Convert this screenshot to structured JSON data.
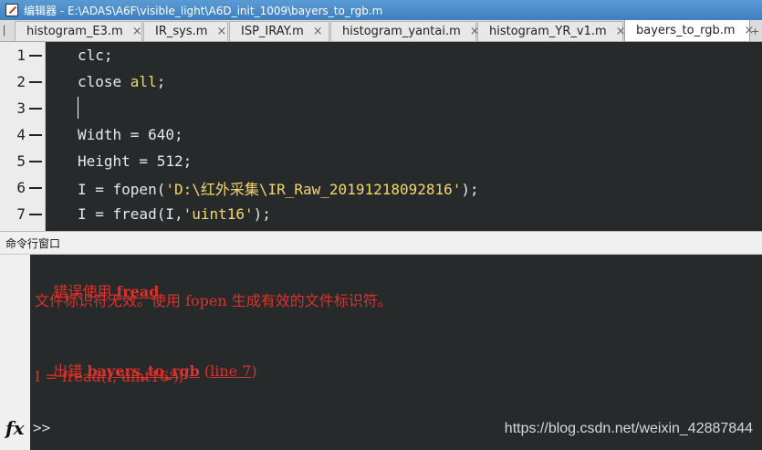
{
  "window": {
    "title": "编辑器 - E:\\ADAS\\A6F\\visible_light\\A6D_init_1009\\bayers_to_rgb.m"
  },
  "tabs": [
    {
      "label": "histogram_E3.m"
    },
    {
      "label": "IR_sys.m"
    },
    {
      "label": "ISP_IRAY.m"
    },
    {
      "label": "histogram_yantai.m"
    },
    {
      "label": "histogram_YR_v1.m"
    },
    {
      "label": "bayers_to_rgb.m"
    }
  ],
  "tab_close_glyph": "×",
  "editor": {
    "lines": [
      {
        "num": "1",
        "parts": [
          {
            "t": "clc;",
            "c": ""
          }
        ]
      },
      {
        "num": "2",
        "parts": [
          {
            "t": "close ",
            "c": ""
          },
          {
            "t": "all",
            "c": "kw"
          },
          {
            "t": ";",
            "c": ""
          }
        ]
      },
      {
        "num": "3",
        "parts": []
      },
      {
        "num": "4",
        "parts": [
          {
            "t": "Width = 640;",
            "c": ""
          }
        ]
      },
      {
        "num": "5",
        "parts": [
          {
            "t": "Height = 512;",
            "c": ""
          }
        ]
      },
      {
        "num": "6",
        "parts": [
          {
            "t": "I = fopen(",
            "c": ""
          },
          {
            "t": "'D:\\红外采集\\IR_Raw_20191218092816'",
            "c": "str"
          },
          {
            "t": ");",
            "c": ""
          }
        ]
      },
      {
        "num": "7",
        "parts": [
          {
            "t": "I = fread(I,",
            "c": ""
          },
          {
            "t": "'uint16'",
            "c": "str"
          },
          {
            "t": ");",
            "c": ""
          }
        ]
      }
    ]
  },
  "command_window": {
    "title": "命令行窗口",
    "error_prefix": "错误使用 ",
    "error_func": "fread",
    "error_message": "文件标识符无效。使用 fopen 生成有效的文件标识符。",
    "location_prefix": "出错 ",
    "location_func": "bayers_to_rgb",
    "location_line": "line 7",
    "error_code": "I = fread(I,'uint16');",
    "prompt": ">>",
    "fx_label": "fx"
  },
  "watermark": "https://blog.csdn.net/weixin_42887844",
  "colors": {
    "editor_bg": "#262a2b",
    "error_red": "#e0302a",
    "title_blue": "#4a8bca"
  }
}
